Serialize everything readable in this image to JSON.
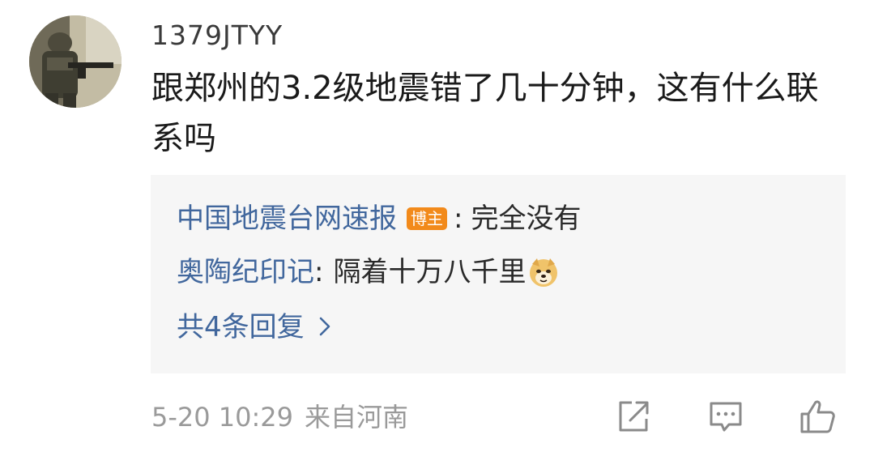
{
  "comment": {
    "username": "1379JTYY",
    "text": "跟郑州的3.2级地震错了几十分钟，这有什么联系吗",
    "avatar": "avatar-soldier-image"
  },
  "replies": [
    {
      "author": "中国地震台网速报",
      "badge": "博主",
      "colon": ":",
      "text": "完全没有"
    },
    {
      "author": "奥陶纪印记",
      "colon": ":",
      "text": "隔着十万八千里",
      "emoji": "doge-emoji"
    }
  ],
  "more_replies": {
    "label": "共4条回复",
    "icon": "chevron-right-icon"
  },
  "meta": {
    "time": "5-20 10:29",
    "location": "来自河南"
  },
  "actions": {
    "share_icon": "share-icon",
    "comment_icon": "comment-icon",
    "like_icon": "thumbs-up-icon"
  },
  "colors": {
    "link": "#41679d",
    "badge": "#f28a1b",
    "meta": "#9a9a9a",
    "reply_bg": "#f6f6f6"
  }
}
